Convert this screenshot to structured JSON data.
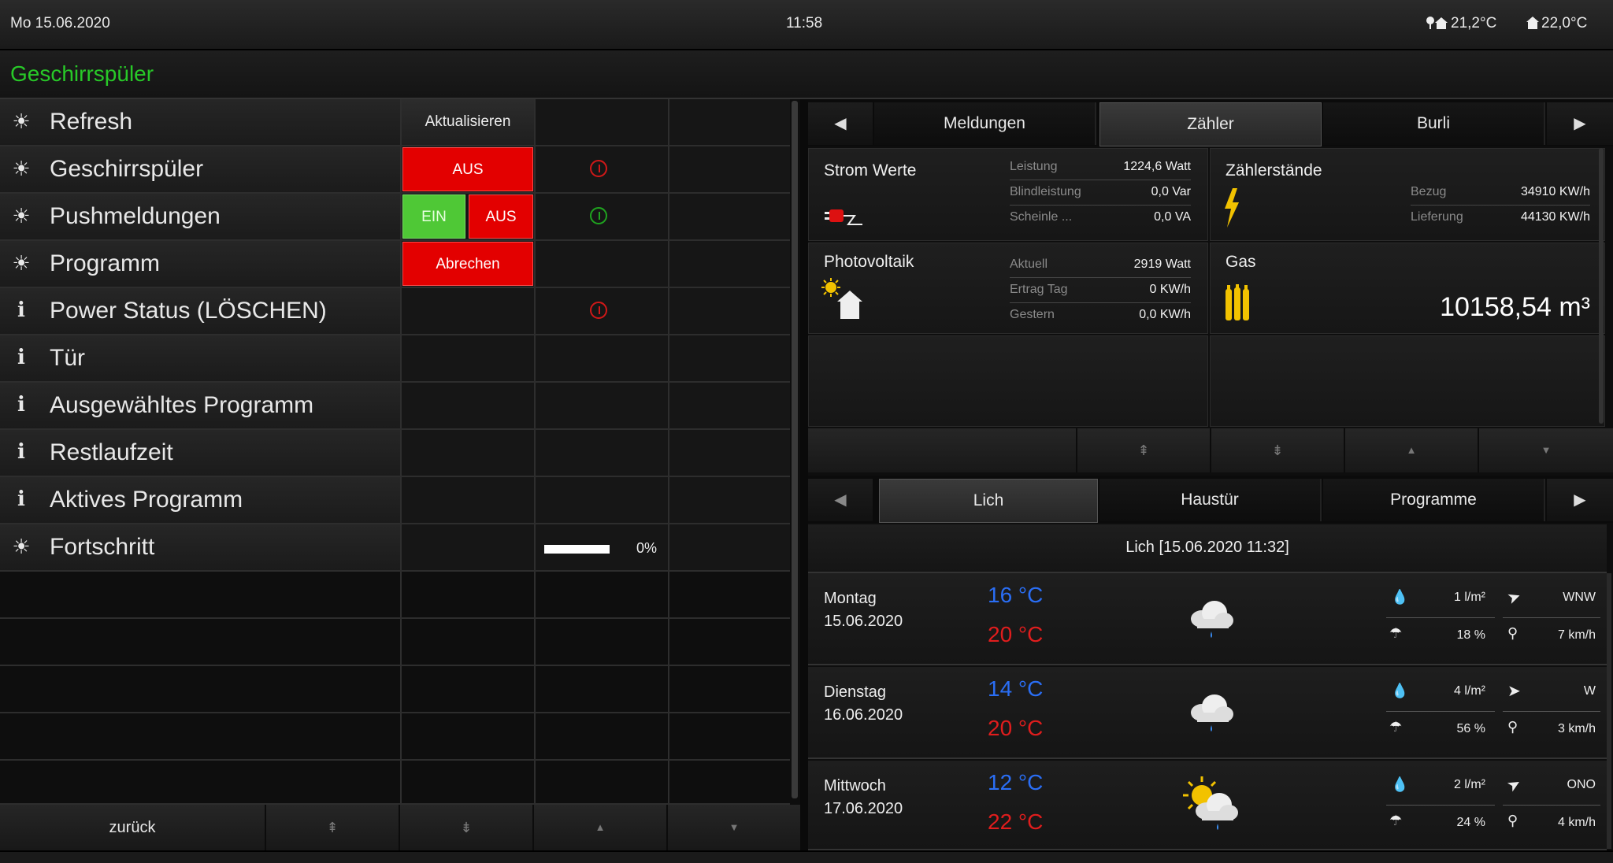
{
  "topbar": {
    "date": "Mo  15.06.2020",
    "time": "11:58",
    "outside_temp": "21,2°C",
    "inside_temp": "22,0°C"
  },
  "title": "Geschirrspüler",
  "rows": [
    {
      "label": "Refresh",
      "icon": "light-icon"
    },
    {
      "label": "Geschirrspüler",
      "icon": "light-icon"
    },
    {
      "label": "Pushmeldungen",
      "icon": "light-icon"
    },
    {
      "label": "Programm",
      "icon": "light-icon"
    },
    {
      "label": "Power Status (LÖSCHEN)",
      "icon": "info-icon"
    },
    {
      "label": "Tür",
      "icon": "info-icon"
    },
    {
      "label": "Ausgewähltes Programm",
      "icon": "info-icon"
    },
    {
      "label": "Restlaufzeit",
      "icon": "info-icon"
    },
    {
      "label": "Aktives Programm",
      "icon": "info-icon"
    },
    {
      "label": "Fortschritt",
      "icon": "light-icon"
    }
  ],
  "buttons": {
    "refresh": "Aktualisieren",
    "dish_off": "AUS",
    "push_on": "EIN",
    "push_off": "AUS",
    "abort": "Abrechen"
  },
  "progress": {
    "value": 0,
    "label": "0%"
  },
  "bottom_nav": {
    "back": "zurück"
  },
  "top_tabs": [
    "Meldungen",
    "Zähler",
    "Burli"
  ],
  "strom": {
    "title": "Strom Werte",
    "rows": [
      [
        "Leistung",
        "1224,6 Watt"
      ],
      [
        "Blindleistung",
        "0,0 Var"
      ],
      [
        "Scheinle ...",
        "0,0 VA"
      ]
    ]
  },
  "zaehler": {
    "title": "Zählerstände",
    "rows": [
      [
        "Bezug",
        "34910 KW/h"
      ],
      [
        "Lieferung",
        "44130 KW/h"
      ]
    ]
  },
  "pv": {
    "title": "Photovoltaik",
    "rows": [
      [
        "Aktuell",
        "2919 Watt"
      ],
      [
        "Ertrag Tag",
        "0 KW/h"
      ],
      [
        "Gestern",
        "0,0 KW/h"
      ]
    ]
  },
  "gas": {
    "title": "Gas",
    "value": "10158,54 m³"
  },
  "weather_tabs": [
    "Lich",
    "Haustür",
    "Programme"
  ],
  "weather_header": "Lich  [15.06.2020 11:32]",
  "forecast": [
    {
      "day": "Montag",
      "date": "15.06.2020",
      "low": "16 °C",
      "high": "20 °C",
      "rain": "1 l/m²",
      "prob": "18 %",
      "wind_dir": "WNW",
      "wind": "7 km/h",
      "icon": "rain-cloud-icon"
    },
    {
      "day": "Dienstag",
      "date": "16.06.2020",
      "low": "14 °C",
      "high": "20 °C",
      "rain": "4 l/m²",
      "prob": "56 %",
      "wind_dir": "W",
      "wind": "3 km/h",
      "icon": "rain-cloud-icon"
    },
    {
      "day": "Mittwoch",
      "date": "17.06.2020",
      "low": "12 °C",
      "high": "22 °C",
      "rain": "2 l/m²",
      "prob": "24 %",
      "wind_dir": "ONO",
      "wind": "4 km/h",
      "icon": "sun-rain-cloud-icon"
    }
  ],
  "colors": {
    "title_green": "#28c928",
    "alarm_red": "#e30000",
    "on_green": "#4fc836",
    "temp_low": "#2a6ef5",
    "temp_high": "#e01d1d"
  }
}
